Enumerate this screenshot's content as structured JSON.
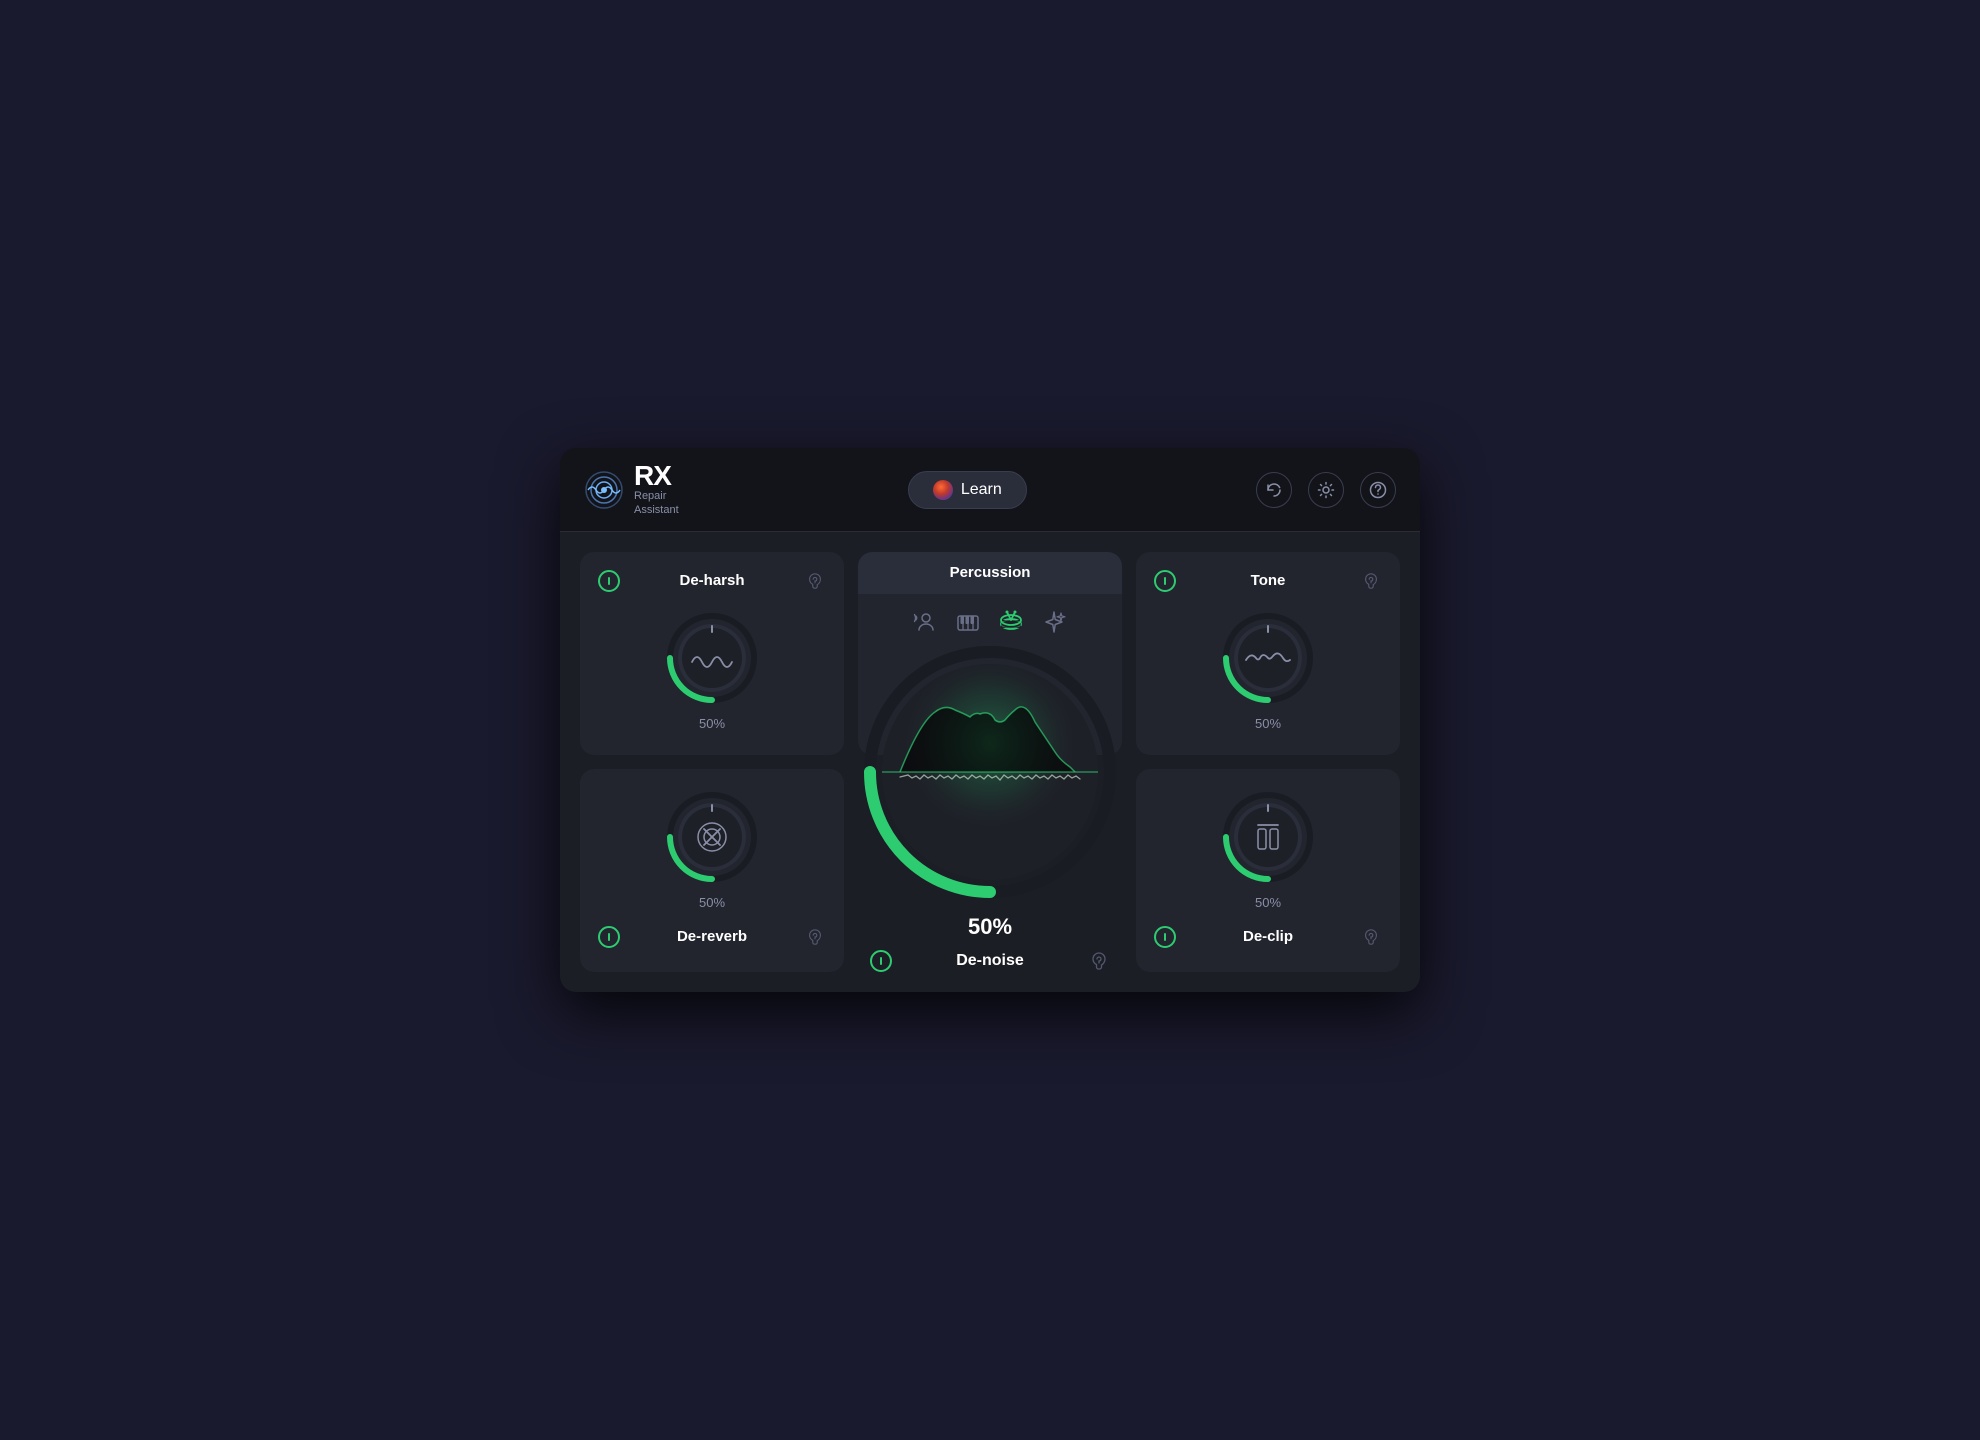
{
  "header": {
    "logo_rx": "RX",
    "logo_subtitle_line1": "Repair",
    "logo_subtitle_line2": "Assistant",
    "learn_button_label": "Learn",
    "icons": {
      "undo": "↩",
      "settings": "⚙",
      "help": "?"
    }
  },
  "modules": {
    "de_harsh": {
      "title": "De-harsh",
      "percentage": "50%",
      "enabled": true
    },
    "percussion": {
      "title": "Percussion",
      "icons": [
        "voice",
        "piano",
        "drums",
        "sparkle"
      ],
      "active_icon": "drums"
    },
    "tone": {
      "title": "Tone",
      "percentage": "50%",
      "enabled": true
    },
    "de_reverb": {
      "title": "De-reverb",
      "percentage": "50%",
      "enabled": true
    },
    "de_noise": {
      "title": "De-noise",
      "percentage": "50%",
      "enabled": true
    },
    "de_clip": {
      "title": "De-clip",
      "percentage": "50%",
      "enabled": true
    }
  },
  "colors": {
    "accent_green": "#2ecc71",
    "accent_green_dark": "#1a8c4e",
    "bg_card": "#22242e",
    "bg_header": "#2a2d3a",
    "text_primary": "#ffffff",
    "text_secondary": "#8a8fa8"
  }
}
